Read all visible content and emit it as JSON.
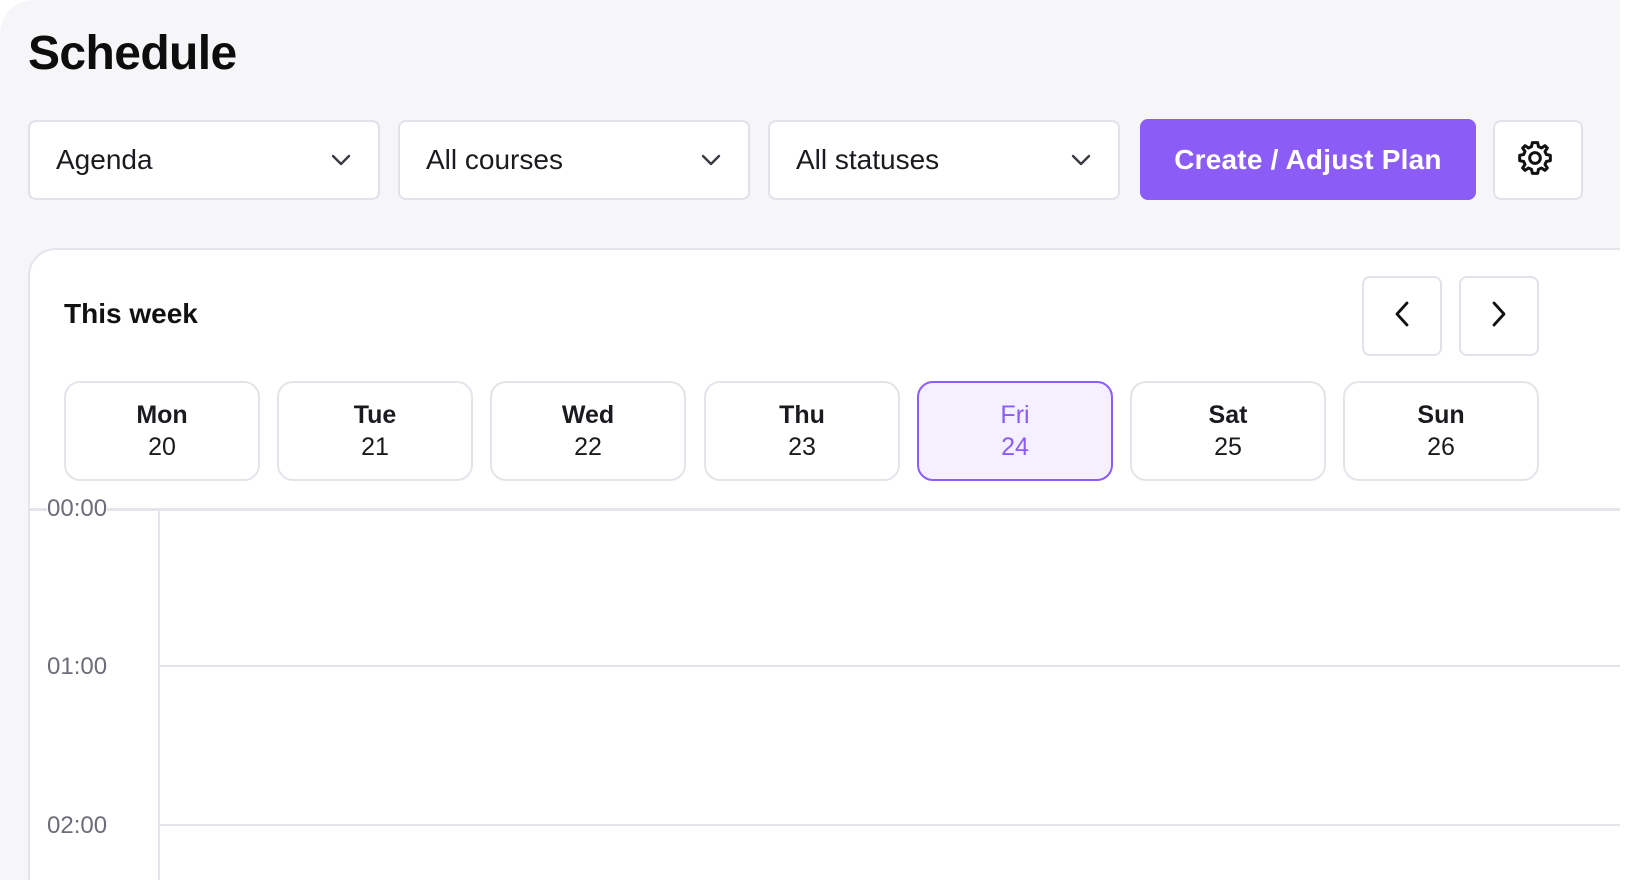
{
  "header": {
    "title": "Schedule"
  },
  "toolbar": {
    "view_select": "Agenda",
    "course_select": "All courses",
    "status_select": "All statuses",
    "create_button": "Create / Adjust Plan",
    "settings_icon": "gear-icon",
    "chevron_icon": "chevron-down-icon"
  },
  "week": {
    "title": "This week",
    "prev_icon": "chevron-left-icon",
    "next_icon": "chevron-right-icon",
    "selected_day": "Fri",
    "days": [
      {
        "name": "Mon",
        "date": "20"
      },
      {
        "name": "Tue",
        "date": "21"
      },
      {
        "name": "Wed",
        "date": "22"
      },
      {
        "name": "Thu",
        "date": "23"
      },
      {
        "name": "Fri",
        "date": "24"
      },
      {
        "name": "Sat",
        "date": "25"
      },
      {
        "name": "Sun",
        "date": "26"
      }
    ]
  },
  "timeline": {
    "hours": [
      "00:00",
      "01:00",
      "02:00"
    ]
  },
  "colors": {
    "accent": "#8b5cf6",
    "accent_light": "#f5f0ff",
    "background": "#f6f5f8",
    "border": "#e3e1e8",
    "muted_text": "#6e6c78"
  }
}
